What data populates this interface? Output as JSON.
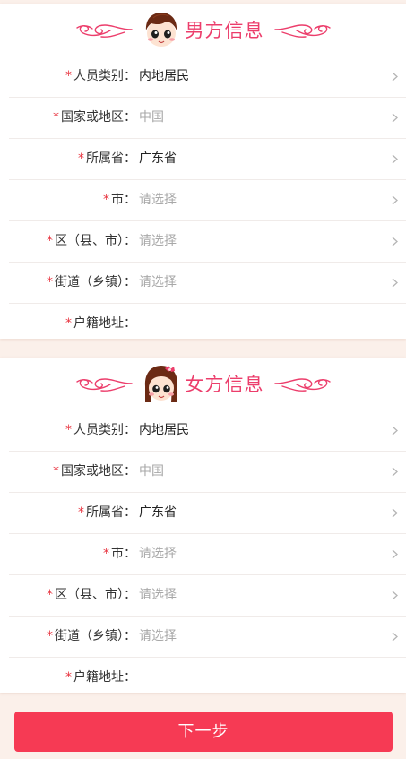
{
  "male_section": {
    "title": "男方信息",
    "rows": [
      {
        "label": "人员类别：",
        "value": "内地居民"
      },
      {
        "label": "国家或地区：",
        "value": "中国"
      },
      {
        "label": "所属省：",
        "value": "广东省"
      },
      {
        "label": "市：",
        "value": "请选择"
      },
      {
        "label": "区（县、市）：",
        "value": "请选择"
      },
      {
        "label": "街道（乡镇）：",
        "value": "请选择"
      },
      {
        "label": "户籍地址：",
        "value": ""
      }
    ]
  },
  "female_section": {
    "title": "女方信息",
    "rows": [
      {
        "label": "人员类别：",
        "value": "内地居民"
      },
      {
        "label": "国家或地区：",
        "value": "中国"
      },
      {
        "label": "所属省：",
        "value": "广东省"
      },
      {
        "label": "市：",
        "value": "请选择"
      },
      {
        "label": "区（县、市）：",
        "value": "请选择"
      },
      {
        "label": "街道（乡镇）：",
        "value": "请选择"
      },
      {
        "label": "户籍地址：",
        "value": ""
      }
    ]
  },
  "required_marker": "*",
  "next_button_label": "下一步",
  "colors": {
    "accent": "#ec3d6b",
    "button": "#f63a54",
    "required": "#e8333f",
    "placeholder": "#a8a8a8",
    "background": "#fbf0ea"
  },
  "icons": {
    "flourish": "decorative-swirl-icon",
    "male_avatar": "boy-face-icon",
    "female_avatar": "girl-face-icon",
    "row_arrow": "chevron-right-icon"
  }
}
